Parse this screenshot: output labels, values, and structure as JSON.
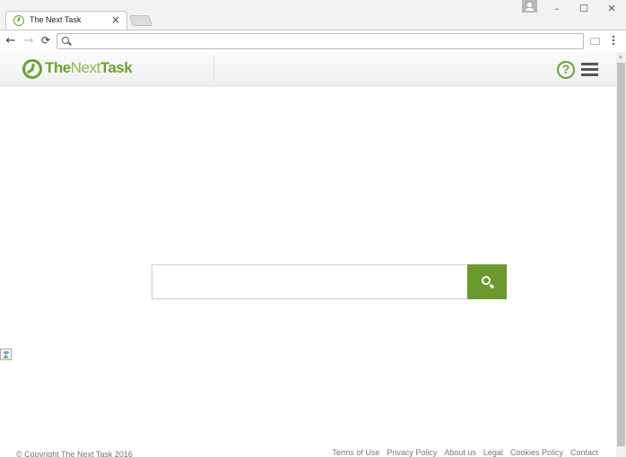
{
  "browser": {
    "tab": {
      "title": "The Next Task",
      "close_glyph": "×"
    },
    "window_controls": {
      "minimize": "–",
      "maximize": "☐",
      "close": "✕"
    },
    "nav": {
      "back": "←",
      "forward": "→",
      "reload": "C"
    },
    "address_bar": {
      "value": ""
    }
  },
  "site": {
    "brand": {
      "part1": "The",
      "part2": "Next",
      "part3": "Task",
      "color_primary": "#6aa232",
      "color_light": "#8dbb45"
    },
    "help_glyph": "?",
    "search": {
      "value": "",
      "placeholder": "",
      "button_color": "#6a9a2e"
    },
    "footer": {
      "copyright": "© Copyright The Next Task 2016",
      "links": [
        "Terms of Use",
        "Privacy Policy",
        "About us",
        "Legal",
        "Cookies Policy",
        "Contact"
      ]
    }
  }
}
